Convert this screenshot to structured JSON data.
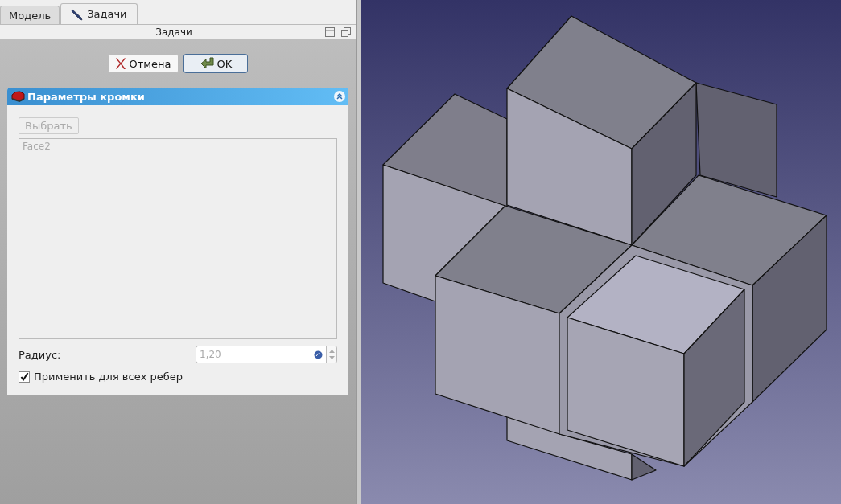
{
  "tabs": [
    {
      "label": "Модель",
      "selected": false
    },
    {
      "label": "Задачи",
      "selected": true
    }
  ],
  "panel": {
    "title": "Задачи"
  },
  "dialog_buttons": [
    {
      "label": "Отмена",
      "kind": "cancel"
    },
    {
      "label": "OK",
      "kind": "ok"
    }
  ],
  "section": {
    "title": "Параметры кромки",
    "expanded": true
  },
  "select_button": {
    "label": "Выбрать",
    "disabled": true
  },
  "faces": [
    "Face2"
  ],
  "radius": {
    "label": "Радиус:",
    "value": "1,20"
  },
  "apply_all": {
    "label": "Применить для всех ребер",
    "checked": true
  }
}
